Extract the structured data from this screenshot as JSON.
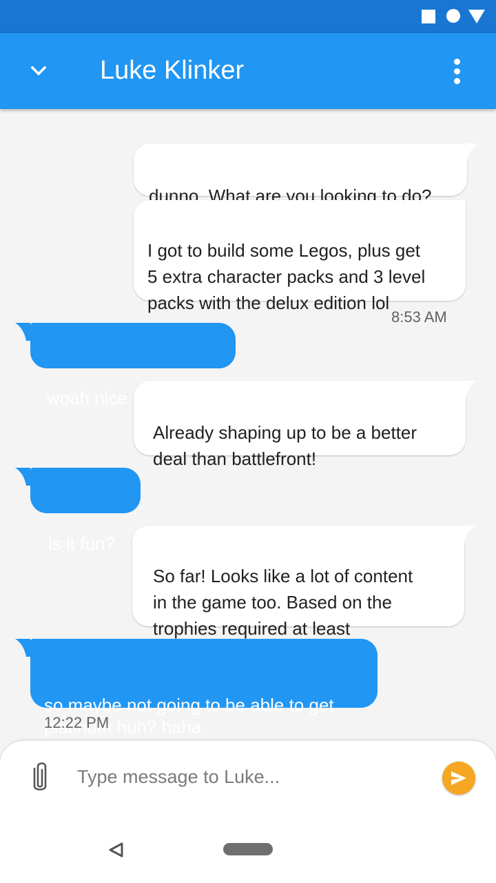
{
  "header": {
    "title": "Luke Klinker",
    "collapse_icon": "chevron-down-icon",
    "menu_icon": "more-vertical-icon",
    "colors": {
      "status_bar": "#1976d2",
      "app_bar": "#2196f3"
    }
  },
  "status_bar": {
    "icons": [
      "square-icon",
      "circle-icon",
      "triangle-icon"
    ]
  },
  "messages": [
    {
      "direction": "out",
      "text": "dunno. What are you looking to do?"
    },
    {
      "direction": "out",
      "text": "I got to build some Legos, plus get\n5 extra character packs and 3 level\npacks with the delux edition lol"
    },
    {
      "direction": "out",
      "time": "8:53 AM"
    },
    {
      "direction": "in",
      "text": "woah nice one haha"
    },
    {
      "direction": "out",
      "text": "Already shaping up to be a better\ndeal than battlefront!"
    },
    {
      "direction": "in",
      "text": "is it fun?"
    },
    {
      "direction": "out",
      "text": "So far! Looks like a lot of content\nin the game too. Based on the\ntrophies required at least"
    },
    {
      "direction": "in",
      "text": "so maybe not going to be able to get\nplatinum huh? haha"
    },
    {
      "direction": "in",
      "time": "12:22 PM"
    }
  ],
  "composer": {
    "placeholder": "Type message to Luke...",
    "value": "",
    "attach_icon": "paperclip-icon",
    "send_icon": "send-icon",
    "send_color": "#f5a623"
  },
  "nav": {
    "back_icon": "back-triangle-icon",
    "home_icon": "home-pill-icon"
  }
}
